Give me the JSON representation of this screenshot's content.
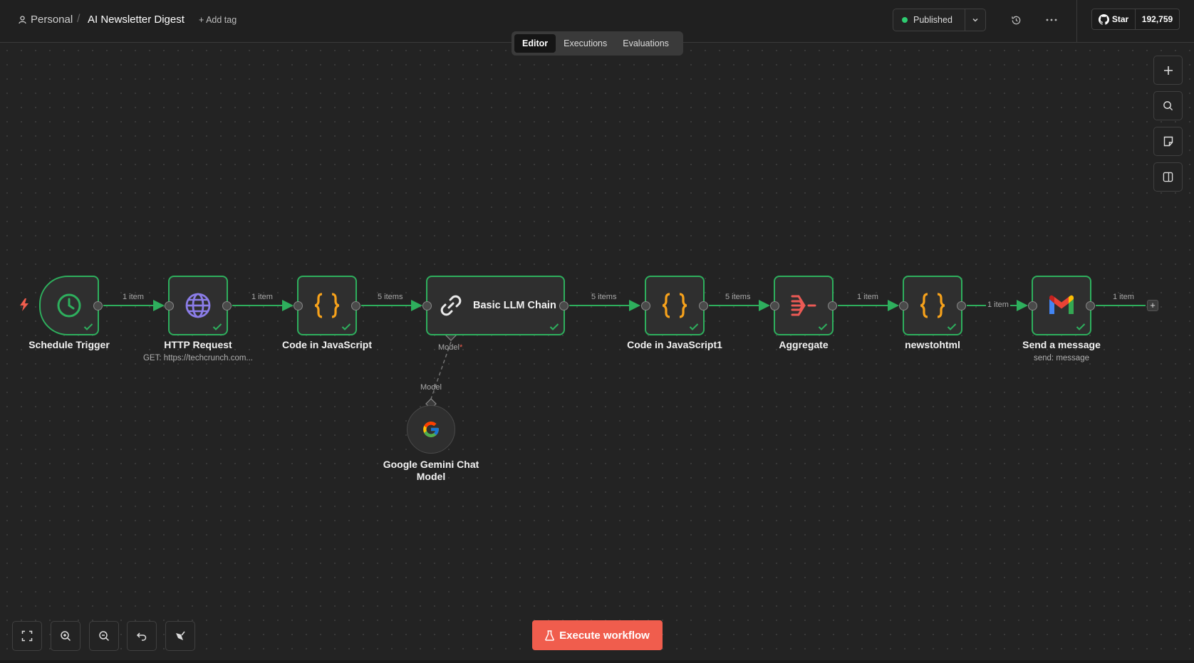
{
  "header": {
    "breadcrumb_project": "Personal",
    "breadcrumb_sep": "/",
    "workflow_title": "AI Newsletter Digest",
    "add_tag": "+ Add tag",
    "publish_status": "Published",
    "github_star": "Star",
    "github_count": "192,759"
  },
  "tabs": [
    {
      "label": "Editor",
      "active": true
    },
    {
      "label": "Executions",
      "active": false
    },
    {
      "label": "Evaluations",
      "active": false
    }
  ],
  "nodes": {
    "schedule": {
      "label": "Schedule Trigger",
      "icon": "clock-icon"
    },
    "http": {
      "label": "HTTP Request",
      "sub": "GET: https://techcrunch.com...",
      "icon": "globe-icon"
    },
    "code1": {
      "label": "Code in JavaScript",
      "icon": "braces-icon"
    },
    "llm": {
      "label": "Basic LLM Chain",
      "icon": "link-icon",
      "port_label": "Model",
      "port_required": "*"
    },
    "code2": {
      "label": "Code in JavaScript1",
      "icon": "braces-icon"
    },
    "aggregate": {
      "label": "Aggregate",
      "icon": "aggregate-icon"
    },
    "newstohtml": {
      "label": "newstohtml",
      "icon": "braces-icon"
    },
    "gmail": {
      "label": "Send a message",
      "sub": "send: message",
      "icon": "gmail-icon"
    },
    "gemini": {
      "label_line1": "Google Gemini Chat",
      "label_line2": "Model",
      "port_label": "Model",
      "icon": "google-icon"
    }
  },
  "edges": {
    "e1": "1 item",
    "e2": "1 item",
    "e3": "5 items",
    "e4": "5 items",
    "e5": "5 items",
    "e6": "1 item",
    "e7": "1 item",
    "e8": "1 item"
  },
  "footer": {
    "execute_label": "Execute workflow"
  },
  "colors": {
    "accent_green": "#2eaf5d",
    "execute_red": "#f05d4d",
    "code_orange": "#f7a21b",
    "aggregate_red": "#ec5a55",
    "globe_purple": "#8b7de8"
  }
}
